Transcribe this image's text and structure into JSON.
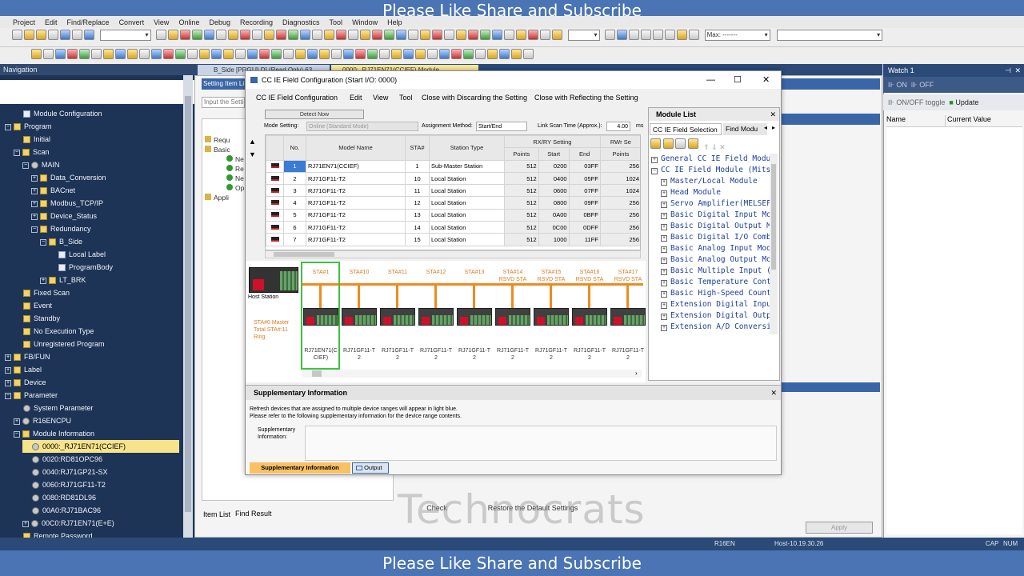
{
  "banner": {
    "top": "Please Like Share and Subscribe",
    "bottom": "Please Like Share and Subscribe"
  },
  "menu": [
    "Project",
    "Edit",
    "Find/Replace",
    "Convert",
    "View",
    "Online",
    "Debug",
    "Recording",
    "Diagnostics",
    "Tool",
    "Window",
    "Help"
  ],
  "toolbar": {
    "max_label": "Max: -------"
  },
  "nav": {
    "title": "Navigation",
    "items": [
      {
        "label": "Module Configuration",
        "indent": 1,
        "exp": "",
        "icon": "doc"
      },
      {
        "label": "Program",
        "indent": 0,
        "exp": "⊟",
        "icon": "folder"
      },
      {
        "label": "Initial",
        "indent": 1,
        "exp": "",
        "icon": "folder"
      },
      {
        "label": "Scan",
        "indent": 1,
        "exp": "⊟",
        "icon": "folder"
      },
      {
        "label": "MAIN",
        "indent": 2,
        "exp": "⊟",
        "icon": "gear"
      },
      {
        "label": "Data_Conversion",
        "indent": 3,
        "exp": "⊞",
        "icon": "folder"
      },
      {
        "label": "BACnet",
        "indent": 3,
        "exp": "⊞",
        "icon": "folder"
      },
      {
        "label": "Modbus_TCP/IP",
        "indent": 3,
        "exp": "⊞",
        "icon": "folder"
      },
      {
        "label": "Device_Status",
        "indent": 3,
        "exp": "⊞",
        "icon": "folder"
      },
      {
        "label": "Redundancy",
        "indent": 3,
        "exp": "⊟",
        "icon": "folder"
      },
      {
        "label": "B_Side",
        "indent": 4,
        "exp": "⊟",
        "icon": "folder"
      },
      {
        "label": "Local Label",
        "indent": 5,
        "exp": "",
        "icon": "doc"
      },
      {
        "label": "ProgramBody",
        "indent": 5,
        "exp": "",
        "icon": "doc"
      },
      {
        "label": "LT_BRK",
        "indent": 4,
        "exp": "⊞",
        "icon": "folder"
      },
      {
        "label": "Fixed Scan",
        "indent": 1,
        "exp": "",
        "icon": "folder"
      },
      {
        "label": "Event",
        "indent": 1,
        "exp": "",
        "icon": "folder"
      },
      {
        "label": "Standby",
        "indent": 1,
        "exp": "",
        "icon": "folder"
      },
      {
        "label": "No Execution Type",
        "indent": 1,
        "exp": "",
        "icon": "folder"
      },
      {
        "label": "Unregistered Program",
        "indent": 1,
        "exp": "",
        "icon": "folder"
      },
      {
        "label": "FB/FUN",
        "indent": 0,
        "exp": "⊞",
        "icon": "folder"
      },
      {
        "label": "Label",
        "indent": 0,
        "exp": "⊞",
        "icon": "folder"
      },
      {
        "label": "Device",
        "indent": 0,
        "exp": "⊞",
        "icon": "folder"
      },
      {
        "label": "Parameter",
        "indent": 0,
        "exp": "⊟",
        "icon": "folder"
      },
      {
        "label": "System Parameter",
        "indent": 1,
        "exp": "",
        "icon": "gear"
      },
      {
        "label": "R16ENCPU",
        "indent": 1,
        "exp": "⊞",
        "icon": "gear"
      },
      {
        "label": "Module Information",
        "indent": 1,
        "exp": "⊟",
        "icon": "folder"
      },
      {
        "label": "0000:_RJ71EN71(CCIEF)",
        "indent": 2,
        "exp": "",
        "icon": "gear",
        "selected": true
      },
      {
        "label": "0020:RD81OPC96",
        "indent": 2,
        "exp": "",
        "icon": "gear"
      },
      {
        "label": "0040:RJ71GP21-SX",
        "indent": 2,
        "exp": "",
        "icon": "gear"
      },
      {
        "label": "0060:RJ71GF11-T2",
        "indent": 2,
        "exp": "",
        "icon": "gear"
      },
      {
        "label": "0080:RD81DL96",
        "indent": 2,
        "exp": "",
        "icon": "gear"
      },
      {
        "label": "00A0:RJ71BAC96",
        "indent": 2,
        "exp": "",
        "icon": "gear"
      },
      {
        "label": "00C0:RJ71EN71(E+E)",
        "indent": 2,
        "exp": "⊞",
        "icon": "gear"
      },
      {
        "label": "Remote Password",
        "indent": 1,
        "exp": "",
        "icon": "folder"
      }
    ]
  },
  "tabs": {
    "tab1": "B_Side [PRG] [LD] (Read Only) 63",
    "tab2": "0000:_RJ71EN71(CCIEF) Module..."
  },
  "bg_panel": {
    "header": "Setting Item Li",
    "input_placeholder": "Input the Setting",
    "tree": [
      "Requ",
      "Basic",
      "Ne",
      "Re",
      "Ne",
      "Op",
      "Appli"
    ],
    "bottom_tabs": [
      "Item List",
      "Find Result"
    ],
    "buttons": {
      "check": "Check",
      "restore": "Restore the Default Settings",
      "apply": "Apply"
    }
  },
  "watermark": "Technocrats",
  "watch": {
    "title": "Watch 1",
    "btn_on": "ON",
    "btn_off": "OFF",
    "btn_toggle": "ON/OFF toggle",
    "btn_update": "Update",
    "col_name": "Name",
    "col_value": "Current Value"
  },
  "statusbar": {
    "cpu": "R16EN",
    "host": "Host-10.19.30.26",
    "cap": "CAP",
    "num": "NUM"
  },
  "ccie": {
    "title": "CC IE Field Configuration (Start I/O: 0000)",
    "menu": [
      "CC IE Field Configuration",
      "Edit",
      "View",
      "Tool",
      "Close with Discarding the Setting",
      "Close with Reflecting the Setting"
    ],
    "detect_now": "Detect Now",
    "mode_label": "Mode Setting:",
    "mode_value": "Online (Standard Mode)",
    "assign_label": "Assignment Method:",
    "assign_value": "Start/End",
    "scan_label": "Link Scan Time (Approx.):",
    "scan_value": "4.00",
    "scan_unit": "ms",
    "headers": {
      "no": "No.",
      "model": "Model Name",
      "sta": "STA#",
      "type": "Station Type",
      "rxry": "RX/RY Setting",
      "points": "Points",
      "start": "Start",
      "end": "End",
      "rwr": "RWr Se",
      "rwr_points": "Points"
    },
    "rows": [
      {
        "no": "1",
        "model": "RJ71EN71(CCIEF)",
        "sta": "1",
        "type": "Sub-Master Station",
        "points": "512",
        "start": "0200",
        "end": "03FF",
        "rwr": "256"
      },
      {
        "no": "2",
        "model": "RJ71GF11-T2",
        "sta": "10",
        "type": "Local Station",
        "points": "512",
        "start": "0400",
        "end": "05FF",
        "rwr": "1024"
      },
      {
        "no": "3",
        "model": "RJ71GF11-T2",
        "sta": "11",
        "type": "Local Station",
        "points": "512",
        "start": "0600",
        "end": "07FF",
        "rwr": "1024"
      },
      {
        "no": "4",
        "model": "RJ71GF11-T2",
        "sta": "12",
        "type": "Local Station",
        "points": "512",
        "start": "0800",
        "end": "09FF",
        "rwr": "256"
      },
      {
        "no": "5",
        "model": "RJ71GF11-T2",
        "sta": "13",
        "type": "Local Station",
        "points": "512",
        "start": "0A00",
        "end": "0BFF",
        "rwr": "256"
      },
      {
        "no": "6",
        "model": "RJ71GF11-T2",
        "sta": "14",
        "type": "Local Station",
        "points": "512",
        "start": "0C00",
        "end": "0DFF",
        "rwr": "256"
      },
      {
        "no": "7",
        "model": "RJ71GF11-T2",
        "sta": "15",
        "type": "Local Station",
        "points": "512",
        "start": "1000",
        "end": "11FF",
        "rwr": "256"
      }
    ],
    "host_label": "Host Station",
    "host_info": [
      "STA#0 Master",
      "Total STA#:11",
      "Ring"
    ],
    "stations": [
      {
        "label": "STA#1",
        "name": [
          "RJ71EN71(C",
          "CIEF)"
        ]
      },
      {
        "label": "STA#10",
        "name": [
          "RJ71GF11-T",
          "2"
        ]
      },
      {
        "label": "STA#11",
        "name": [
          "RJ71GF11-T",
          "2"
        ]
      },
      {
        "label": "STA#12",
        "name": [
          "RJ71GF11-T",
          "2"
        ]
      },
      {
        "label": "STA#13",
        "name": [
          "RJ71GF11-T",
          "2"
        ]
      },
      {
        "label": "STA#14",
        "sub": "RSVD STA",
        "name": [
          "RJ71GF11-T",
          "2"
        ]
      },
      {
        "label": "STA#15",
        "sub": "RSVD STA",
        "name": [
          "RJ71GF11-T",
          "2"
        ]
      },
      {
        "label": "STA#16",
        "sub": "RSVD STA",
        "name": [
          "RJ71GF11-T",
          "2"
        ]
      },
      {
        "label": "STA#17",
        "sub": "RSVD STA",
        "name": [
          "RJ71GF11-T",
          "2"
        ]
      }
    ],
    "supp": {
      "title": "Supplementary Information",
      "line1": "Refresh devices that are assigned to multiple device ranges will appear in light blue.",
      "line2": "Please refer to the following supplementary information for the device range contents.",
      "field_label": [
        "Supplementary",
        "Information:"
      ],
      "tab_active": "Supplementary Information",
      "tab_output": "Output"
    }
  },
  "module_list": {
    "title": "Module List",
    "tab1": "CC IE Field Selection",
    "tab2": "Find Modu",
    "items": [
      {
        "label": "General CC IE Field Modul",
        "exp": "⊞",
        "indent": 0
      },
      {
        "label": "CC IE Field Module (Mitsu",
        "exp": "⊟",
        "indent": 0
      },
      {
        "label": "Master/Local Module",
        "exp": "⊞",
        "indent": 1
      },
      {
        "label": "Head Module",
        "exp": "⊞",
        "indent": 1
      },
      {
        "label": "Servo Amplifier(MELSEF",
        "exp": "⊞",
        "indent": 1
      },
      {
        "label": "Basic Digital Input Modu",
        "exp": "⊞",
        "indent": 1
      },
      {
        "label": "Basic Digital Output Mo",
        "exp": "⊞",
        "indent": 1
      },
      {
        "label": "Basic Digital I/O Combir",
        "exp": "⊞",
        "indent": 1
      },
      {
        "label": "Basic Analog Input Modu",
        "exp": "⊞",
        "indent": 1
      },
      {
        "label": "Basic Analog Output Mo",
        "exp": "⊞",
        "indent": 1
      },
      {
        "label": "Basic Multiple Input (Vo",
        "exp": "⊞",
        "indent": 1
      },
      {
        "label": "Basic Temperature Cont",
        "exp": "⊞",
        "indent": 1
      },
      {
        "label": "Basic High-Speed Count",
        "exp": "⊞",
        "indent": 1
      },
      {
        "label": "Extension Digital Input M",
        "exp": "⊞",
        "indent": 1
      },
      {
        "label": "Extension Digital Output",
        "exp": "⊞",
        "indent": 1
      },
      {
        "label": "Extension A/D Conversi",
        "exp": "⊞",
        "indent": 1
      }
    ]
  }
}
